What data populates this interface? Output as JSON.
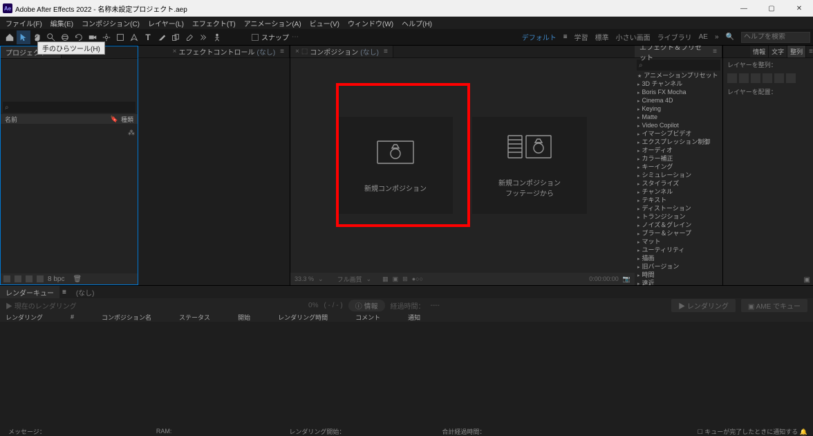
{
  "title": "Adobe After Effects 2022 - 名称未設定プロジェクト.aep",
  "app_badge": "Ae",
  "menu": [
    "ファイル(F)",
    "編集(E)",
    "コンポジション(C)",
    "レイヤー(L)",
    "エフェクト(T)",
    "アニメーション(A)",
    "ビュー(V)",
    "ウィンドウ(W)",
    "ヘルプ(H)"
  ],
  "tooltip": "手のひらツール(H)",
  "snap": "スナップ",
  "workspaces": {
    "default": "デフォルト",
    "learn": "学習",
    "standard": "標準",
    "small": "小さい画面",
    "lib": "ライブラリ",
    "ae_icon": "AE"
  },
  "search_placeholder": "ヘルプを検索",
  "panels": {
    "project": "プロジェクト",
    "effect_controls": "エフェクトコントロール",
    "effect_controls_none": "(なし)",
    "composition": "コンポジション",
    "composition_none": "(なし)",
    "effects_presets": "エフェクト＆プリセット",
    "align_tabs": [
      "情報",
      "文字",
      "整列"
    ],
    "align_layers": "レイヤーを整列：",
    "align_place": "レイヤーを配置："
  },
  "proj_cols": {
    "name": "名前",
    "type": "種類"
  },
  "proj_footer_bpc": "8 bpc",
  "comp_cards": {
    "new_comp": "新規コンポジション",
    "new_from": "新規コンポジション\nフッテージから"
  },
  "comp_footer": {
    "zoom": "33.3 %",
    "quality": "フル画質",
    "time": "0:00:00:00"
  },
  "effects_categories": [
    {
      "label": "アニメーションプリセット",
      "star": true
    },
    {
      "label": "3D チャンネル"
    },
    {
      "label": "Boris FX Mocha"
    },
    {
      "label": "Cinema 4D"
    },
    {
      "label": "Keying"
    },
    {
      "label": "Matte"
    },
    {
      "label": "Video Copilot"
    },
    {
      "label": "イマーシブビデオ"
    },
    {
      "label": "エクスプレッション制御"
    },
    {
      "label": "オーディオ"
    },
    {
      "label": "カラー補正"
    },
    {
      "label": "キーイング"
    },
    {
      "label": "シミュレーション"
    },
    {
      "label": "スタイライズ"
    },
    {
      "label": "チャンネル"
    },
    {
      "label": "テキスト"
    },
    {
      "label": "ディストーション"
    },
    {
      "label": "トランジション"
    },
    {
      "label": "ノイズ＆グレイン"
    },
    {
      "label": "ブラー＆シャープ"
    },
    {
      "label": "マット"
    },
    {
      "label": "ユーティリティ"
    },
    {
      "label": "描画"
    },
    {
      "label": "旧バージョン"
    },
    {
      "label": "時間"
    },
    {
      "label": "遠近"
    }
  ],
  "rq": {
    "tab": "レンダーキュー",
    "none": "(なし)",
    "current": "▶ 現在のレンダリング",
    "pct": "0%",
    "dash": "( - / - )",
    "info": "情報",
    "elapsed": "経過時間：",
    "render_btn": "レンダリング",
    "ame_btn": "AME でキュー",
    "cols": [
      "レンダリング",
      "#",
      "コンポジション名",
      "ステータス",
      "開始",
      "レンダリング時間",
      "コメント",
      "通知"
    ]
  },
  "status": {
    "msg": "メッセージ：",
    "ram": "RAM:",
    "render_start": "レンダリング開始：",
    "total_elapsed": "合計経過時間：",
    "notify": "キューが完了したときに通知する"
  }
}
